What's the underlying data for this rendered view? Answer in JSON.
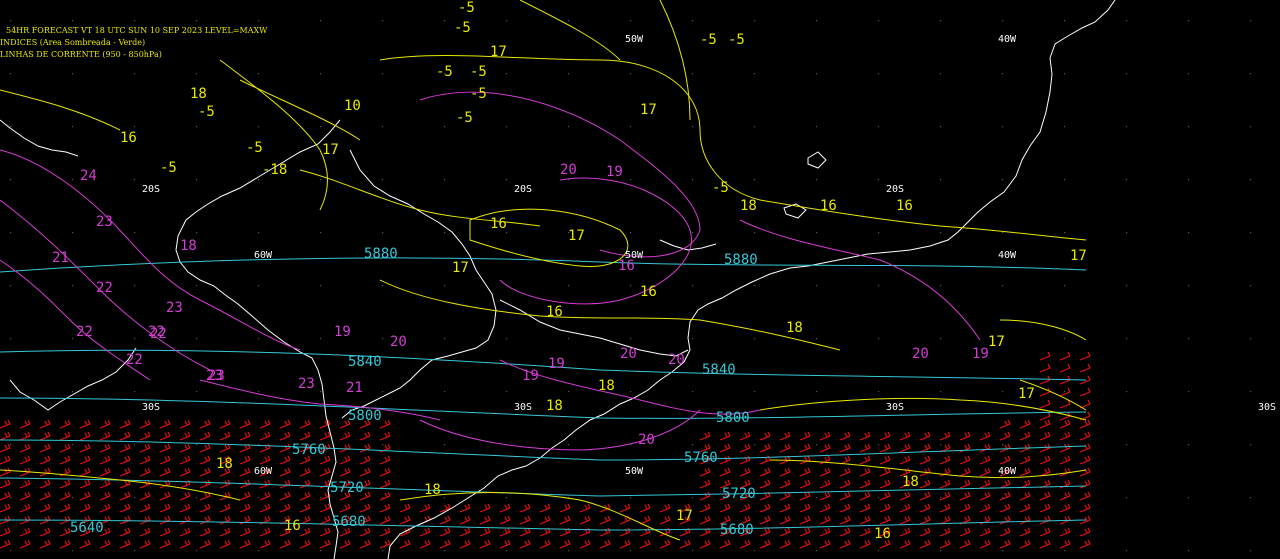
{
  "header": {
    "line1": "54HR FORECAST   VT 18 UTC SUN 10 SEP 2023   LEVEL=MAXW",
    "line2": "INDICES (Area Sombreada - Verde)",
    "line3": "LINHAS DE CORRENTE (950 - 850hPa)"
  },
  "colors": {
    "background": "#000000",
    "coastline": "#ffffff",
    "isotherm_yellow": "#e8e800",
    "humidity_magenta": "#d43cd4",
    "geopotential_cyan": "#36c8d8",
    "wind_barbs_red": "#e81010",
    "header_text": "#e8e800",
    "grid_labels": "#ffffff"
  },
  "grid_labels": [
    "50W",
    "40W",
    "20S",
    "20S",
    "20S",
    "40W",
    "50W",
    "60W",
    "30S",
    "30S",
    "50W",
    "40W",
    "60W",
    "30S",
    "30S"
  ],
  "geopotential_labels": [
    "5880",
    "5880",
    "5840",
    "5840",
    "5800",
    "5800",
    "5760",
    "5760",
    "5720",
    "5720",
    "5680",
    "5680",
    "5640"
  ],
  "yellow_labels": [
    "-5",
    "-5",
    "17",
    "-5",
    "-5",
    "17",
    "18",
    "16",
    "16",
    "17",
    "17",
    "17",
    "18",
    "16",
    "16",
    "17",
    "18",
    "18",
    "17",
    "16",
    "18",
    "18",
    "17",
    "18",
    "16",
    "17",
    "16",
    "18",
    "-5",
    "-5",
    "-5",
    "-5",
    "-5",
    "-5",
    "10",
    "-5",
    "-5",
    "16",
    "-18"
  ],
  "magenta_labels": [
    "20",
    "19",
    "23",
    "24",
    "23",
    "22",
    "22",
    "22",
    "23",
    "22",
    "23",
    "20",
    "21",
    "19",
    "21",
    "19",
    "20",
    "19",
    "20",
    "20",
    "20",
    "19",
    "23",
    "22",
    "16",
    "18"
  ]
}
